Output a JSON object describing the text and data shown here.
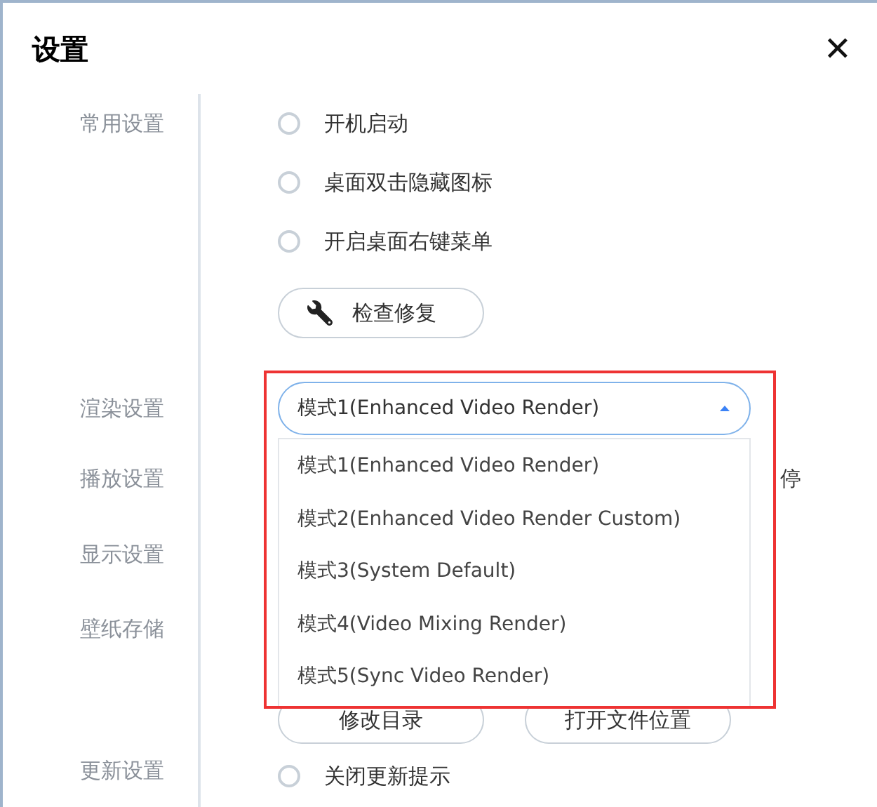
{
  "window": {
    "title": "设置",
    "close": "✕"
  },
  "sections": [
    {
      "label": "常用设置",
      "items": [
        {
          "kind": "radio",
          "label": "开机启动",
          "checked": false
        },
        {
          "kind": "radio",
          "label": "桌面双击隐藏图标",
          "checked": false
        },
        {
          "kind": "radio",
          "label": "开启桌面右键菜单",
          "checked": false
        },
        {
          "kind": "button",
          "label": "检查修复"
        }
      ]
    },
    {
      "label": "渲染设置",
      "items": [
        {
          "kind": "select",
          "value": "模式1(Enhanced Video Render)",
          "expanded": true
        }
      ]
    },
    {
      "label": "播放设置",
      "items": [
        {
          "kind": "clipped",
          "label": "停"
        }
      ]
    },
    {
      "label": "显示设置"
    },
    {
      "label": "壁纸存储",
      "items": [
        {
          "kind": "buttons",
          "labels": [
            "修改目录",
            "打开文件位置"
          ]
        }
      ]
    },
    {
      "label": "更新设置",
      "items": [
        {
          "kind": "radio",
          "label": "关闭更新提示",
          "checked": false
        }
      ]
    }
  ],
  "dropdown": {
    "options": [
      "模式1(Enhanced Video Render)",
      "模式2(Enhanced Video Render Custom)",
      "模式3(System Default)",
      "模式4(Video Mixing Render)",
      "模式5(Sync Video Render)"
    ]
  },
  "highlight_frame": true
}
